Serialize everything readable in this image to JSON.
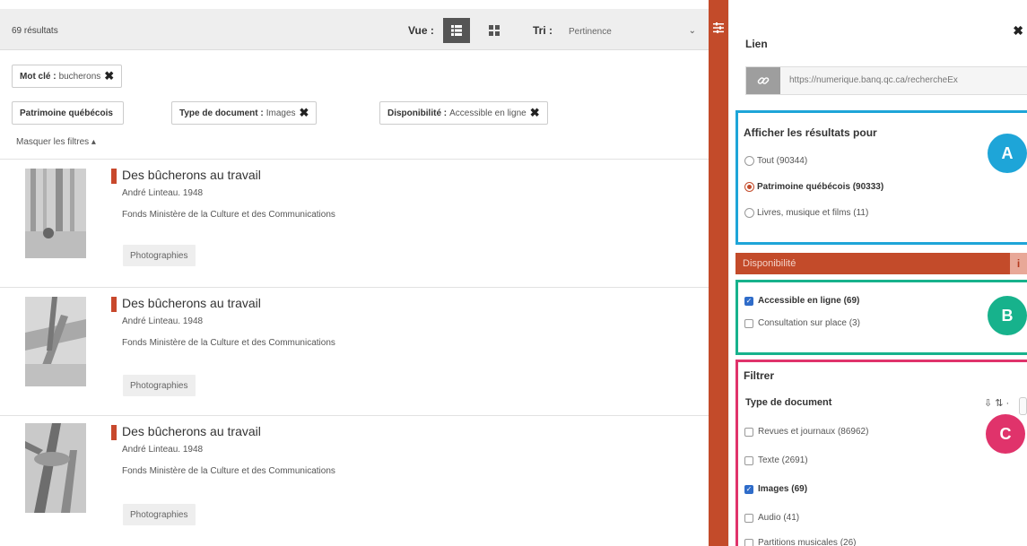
{
  "toolbar": {
    "count": "69 résultats",
    "vue_label": "Vue :",
    "tri_label": "Tri :",
    "sort_value": "Pertinence",
    "sort_caret": "⌄"
  },
  "filters": {
    "keyword_label": "Mot clé :",
    "keyword_value": "bucherons",
    "patrimoine": "Patrimoine québécois",
    "type_label": "Type de document :",
    "type_value": "Images",
    "dispo_label": "Disponibilité :",
    "dispo_value": "Accessible en ligne",
    "remove": "✖",
    "hide": "Masquer les filtres ▴"
  },
  "results": [
    {
      "title": "Des bûcherons au travail",
      "author": "André Linteau. 1948",
      "fonds": "Fonds Ministère de la Culture et des Communications",
      "badge": "Photographies"
    },
    {
      "title": "Des bûcherons au travail",
      "author": "André Linteau. 1948",
      "fonds": "Fonds Ministère de la Culture et des Communications",
      "badge": "Photographies"
    },
    {
      "title": "Des bûcherons au travail",
      "author": "André Linteau. 1948",
      "fonds": "Fonds Ministère de la Culture et des Communications",
      "badge": "Photographies"
    }
  ],
  "panel": {
    "title": "Lien",
    "close": "✖",
    "link_url": "https://numerique.banq.qc.ca/rechercheEx",
    "afficher": {
      "title": "Afficher les résultats pour",
      "options": [
        {
          "label": "Tout (90344)",
          "selected": false
        },
        {
          "label": "Patrimoine québécois (90333)",
          "selected": true
        },
        {
          "label": "Livres, musique et films (11)",
          "selected": false
        }
      ]
    },
    "dispo": {
      "title": "Disponibilité",
      "info": "i",
      "options": [
        {
          "label": "Accessible en ligne (69)",
          "checked": true
        },
        {
          "label": "Consultation sur place (3)",
          "checked": false
        }
      ]
    },
    "filtrer": {
      "title": "Filtrer",
      "subtitle": "Type de document",
      "sort_icons": "⇩ ⇅ ·",
      "options": [
        {
          "label": "Revues et journaux (86962)",
          "checked": false
        },
        {
          "label": "Texte (2691)",
          "checked": false
        },
        {
          "label": "Images (69)",
          "checked": true
        },
        {
          "label": "Audio (41)",
          "checked": false
        },
        {
          "label": "Partitions musicales (26)",
          "checked": false
        }
      ]
    }
  },
  "badges": {
    "a": "A",
    "b": "B",
    "c": "C"
  },
  "colors": {
    "accent": "#c34b2a",
    "box_a": "#1ea5d8",
    "box_b": "#17b28c",
    "box_c": "#e0336b",
    "check": "#2f6cc9"
  }
}
